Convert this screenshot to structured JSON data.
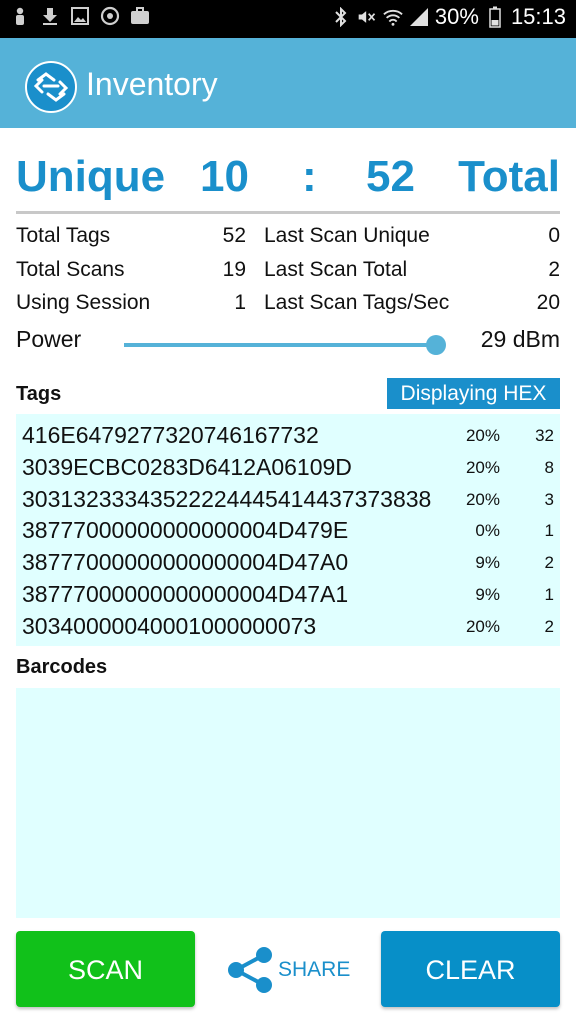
{
  "status_bar": {
    "left_icons": [
      "person-icon",
      "download-icon",
      "image-icon",
      "sync-icon",
      "briefcase-icon"
    ],
    "right_icons": [
      "bluetooth-icon",
      "mute-icon",
      "wifi-icon",
      "signal-icon"
    ],
    "battery": "30%",
    "time": "15:13"
  },
  "app_bar": {
    "title": "Inventory",
    "logo_icon": "rfid-logo-icon"
  },
  "counter": {
    "unique_label": "Unique",
    "unique_value": "10",
    "separator": ":",
    "total_value": "52",
    "total_label": "Total"
  },
  "stats": [
    {
      "label1": "Total Tags",
      "value1": "52",
      "label2": "Last Scan Unique",
      "value2": "0"
    },
    {
      "label1": "Total Scans",
      "value1": "19",
      "label2": "Last Scan Total",
      "value2": "2"
    },
    {
      "label1": "Using Session",
      "value1": "1",
      "label2": "Last Scan Tags/Sec",
      "value2": "20"
    }
  ],
  "power": {
    "label": "Power",
    "value": "29 dBm",
    "slider_fraction": 1.0
  },
  "tags": {
    "label": "Tags",
    "display_mode_button": "Displaying HEX",
    "rows": [
      {
        "epc": "416E6479277320746167732",
        "percent": "20%",
        "count": "32"
      },
      {
        "epc": "3039ECBC0283D6412A06109D",
        "percent": "20%",
        "count": "8"
      },
      {
        "epc": "30313233343522224445414437373838",
        "percent": "20%",
        "count": "3"
      },
      {
        "epc": "38777000000000000004D479E",
        "percent": "0%",
        "count": "1"
      },
      {
        "epc": "38777000000000000004D47A0",
        "percent": "9%",
        "count": "2"
      },
      {
        "epc": "38777000000000000004D47A1",
        "percent": "9%",
        "count": "1"
      },
      {
        "epc": "30340000040001000000073",
        "percent": "20%",
        "count": "2"
      }
    ]
  },
  "barcodes": {
    "label": "Barcodes",
    "rows": []
  },
  "buttons": {
    "scan": "SCAN",
    "share": "SHARE",
    "clear": "CLEAR"
  },
  "colors": {
    "app_bar": "#55b2d8",
    "accent_blue": "#1a8fcb",
    "list_background": "#e0ffff",
    "scan_green": "#11c11a",
    "clear_blue": "#078fc8"
  }
}
